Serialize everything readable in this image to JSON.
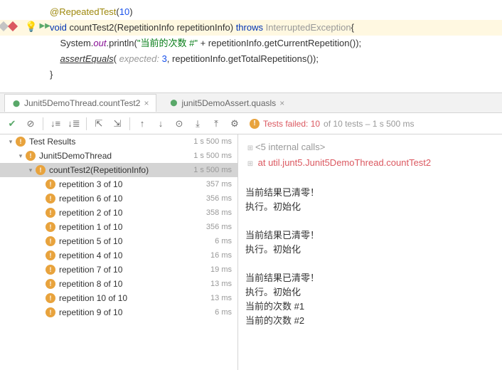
{
  "code": {
    "annotation": "@RepeatedTest",
    "anno_arg": "10",
    "kw_void": "void",
    "method_name": "countTest2",
    "param_type": "RepetitionInfo",
    "param_name": "repetitionInfo",
    "kw_throws": "throws",
    "exception": "InterruptedException",
    "sys": "System",
    "out": "out",
    "println": "println",
    "str_lit": "\"当前的次数 #\"",
    "get_curr": "getCurrentRepetition",
    "assert_eq": "assertEquals",
    "hint": "expected:",
    "exp_val": "3",
    "get_total": "getTotalRepetitions"
  },
  "tabs": {
    "t1": "Junit5DemoThread.countTest2",
    "t2": "junit5DemoAssert.quasls"
  },
  "fail": {
    "prefix": "Tests failed: 10",
    "suffix": " of 10 tests – 1 s 500 ms"
  },
  "tree": {
    "root": "Test Results",
    "root_time": "1 s 500 ms",
    "class": "Junit5DemoThread",
    "class_time": "1 s 500 ms",
    "method": "countTest2(RepetitionInfo)",
    "method_time": "1 s 500 ms",
    "reps": [
      {
        "label": "repetition 3 of 10",
        "time": "357 ms"
      },
      {
        "label": "repetition 6 of 10",
        "time": "356 ms"
      },
      {
        "label": "repetition 2 of 10",
        "time": "358 ms"
      },
      {
        "label": "repetition 1 of 10",
        "time": "356 ms"
      },
      {
        "label": "repetition 5 of 10",
        "time": "6 ms"
      },
      {
        "label": "repetition 4 of 10",
        "time": "16 ms"
      },
      {
        "label": "repetition 7 of 10",
        "time": "19 ms"
      },
      {
        "label": "repetition 8 of 10",
        "time": "13 ms"
      },
      {
        "label": "repetition 10 of 10",
        "time": "13 ms"
      },
      {
        "label": "repetition 9 of 10",
        "time": "6 ms"
      }
    ]
  },
  "console": {
    "internal": "<5 internal calls>",
    "at_line": "at util.junt5.Junit5DemoThread.countTest2",
    "l1": "当前结果已清零！",
    "l2": "执行。初始化",
    "l3": "当前结果已清零！",
    "l4": "执行。初始化",
    "l5": "当前结果已清零！",
    "l6": "执行。初始化",
    "l7": "当前的次数 #1",
    "l8": "当前的次数 #2"
  }
}
